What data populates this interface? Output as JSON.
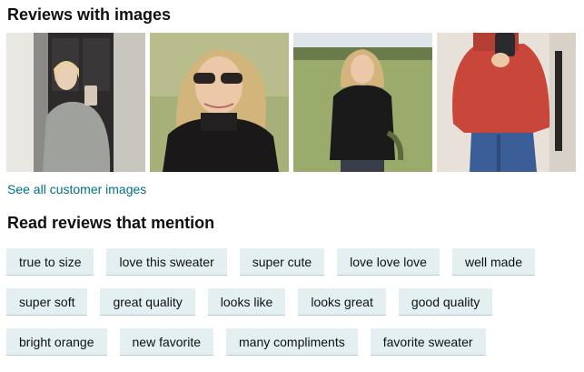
{
  "images_section": {
    "title": "Reviews with images",
    "thumbnails": [
      {
        "icon": "customer-photo"
      },
      {
        "icon": "customer-photo"
      },
      {
        "icon": "customer-photo"
      },
      {
        "icon": "customer-photo"
      }
    ],
    "see_all_label": "See all customer images"
  },
  "mentions_section": {
    "title": "Read reviews that mention",
    "rows": [
      [
        "true to size",
        "love this sweater",
        "super cute",
        "love love love",
        "well made"
      ],
      [
        "super soft",
        "great quality",
        "looks like",
        "looks great",
        "good quality"
      ],
      [
        "bright orange",
        "new favorite",
        "many compliments",
        "favorite sweater"
      ]
    ]
  },
  "colors": {
    "link": "#007185",
    "chip_background": "#e3eff1",
    "text": "#0f1111"
  }
}
